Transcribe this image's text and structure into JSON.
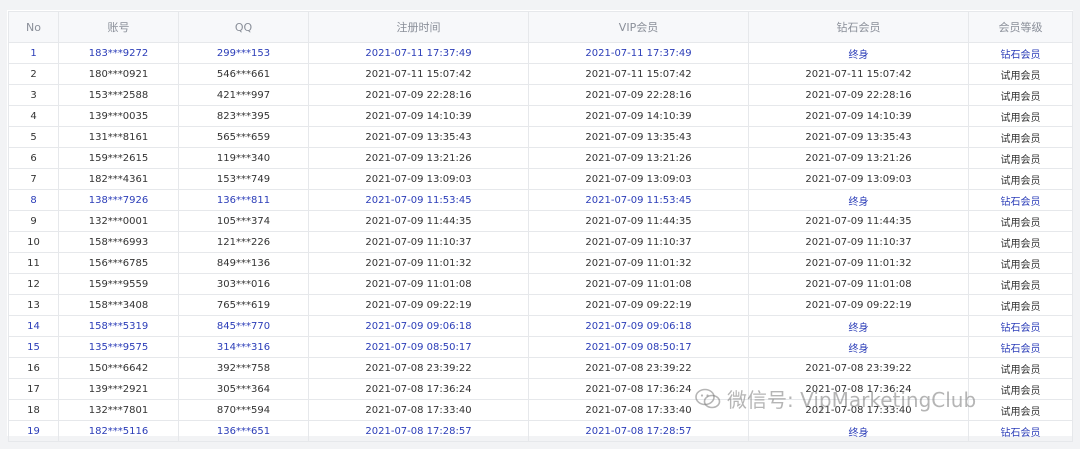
{
  "table": {
    "columns": [
      "No",
      "账号",
      "QQ",
      "注册时间",
      "VIP会员",
      "钻石会员",
      "会员等级"
    ],
    "rows": [
      {
        "no": "1",
        "account": "183***9272",
        "qq": "299***153",
        "registered": "2021-07-11 17:37:49",
        "vip": "2021-07-11 17:37:49",
        "diamond": "终身",
        "level": "钻石会员"
      },
      {
        "no": "2",
        "account": "180***0921",
        "qq": "546***661",
        "registered": "2021-07-11 15:07:42",
        "vip": "2021-07-11 15:07:42",
        "diamond": "2021-07-11 15:07:42",
        "level": "试用会员"
      },
      {
        "no": "3",
        "account": "153***2588",
        "qq": "421***997",
        "registered": "2021-07-09 22:28:16",
        "vip": "2021-07-09 22:28:16",
        "diamond": "2021-07-09 22:28:16",
        "level": "试用会员"
      },
      {
        "no": "4",
        "account": "139***0035",
        "qq": "823***395",
        "registered": "2021-07-09 14:10:39",
        "vip": "2021-07-09 14:10:39",
        "diamond": "2021-07-09 14:10:39",
        "level": "试用会员"
      },
      {
        "no": "5",
        "account": "131***8161",
        "qq": "565***659",
        "registered": "2021-07-09 13:35:43",
        "vip": "2021-07-09 13:35:43",
        "diamond": "2021-07-09 13:35:43",
        "level": "试用会员"
      },
      {
        "no": "6",
        "account": "159***2615",
        "qq": "119***340",
        "registered": "2021-07-09 13:21:26",
        "vip": "2021-07-09 13:21:26",
        "diamond": "2021-07-09 13:21:26",
        "level": "试用会员"
      },
      {
        "no": "7",
        "account": "182***4361",
        "qq": "153***749",
        "registered": "2021-07-09 13:09:03",
        "vip": "2021-07-09 13:09:03",
        "diamond": "2021-07-09 13:09:03",
        "level": "试用会员"
      },
      {
        "no": "8",
        "account": "138***7926",
        "qq": "136***811",
        "registered": "2021-07-09 11:53:45",
        "vip": "2021-07-09 11:53:45",
        "diamond": "终身",
        "level": "钻石会员"
      },
      {
        "no": "9",
        "account": "132***0001",
        "qq": "105***374",
        "registered": "2021-07-09 11:44:35",
        "vip": "2021-07-09 11:44:35",
        "diamond": "2021-07-09 11:44:35",
        "level": "试用会员"
      },
      {
        "no": "10",
        "account": "158***6993",
        "qq": "121***226",
        "registered": "2021-07-09 11:10:37",
        "vip": "2021-07-09 11:10:37",
        "diamond": "2021-07-09 11:10:37",
        "level": "试用会员"
      },
      {
        "no": "11",
        "account": "156***6785",
        "qq": "849***136",
        "registered": "2021-07-09 11:01:32",
        "vip": "2021-07-09 11:01:32",
        "diamond": "2021-07-09 11:01:32",
        "level": "试用会员"
      },
      {
        "no": "12",
        "account": "159***9559",
        "qq": "303***016",
        "registered": "2021-07-09 11:01:08",
        "vip": "2021-07-09 11:01:08",
        "diamond": "2021-07-09 11:01:08",
        "level": "试用会员"
      },
      {
        "no": "13",
        "account": "158***3408",
        "qq": "765***619",
        "registered": "2021-07-09 09:22:19",
        "vip": "2021-07-09 09:22:19",
        "diamond": "2021-07-09 09:22:19",
        "level": "试用会员"
      },
      {
        "no": "14",
        "account": "158***5319",
        "qq": "845***770",
        "registered": "2021-07-09 09:06:18",
        "vip": "2021-07-09 09:06:18",
        "diamond": "终身",
        "level": "钻石会员"
      },
      {
        "no": "15",
        "account": "135***9575",
        "qq": "314***316",
        "registered": "2021-07-09 08:50:17",
        "vip": "2021-07-09 08:50:17",
        "diamond": "终身",
        "level": "钻石会员"
      },
      {
        "no": "16",
        "account": "150***6642",
        "qq": "392***758",
        "registered": "2021-07-08 23:39:22",
        "vip": "2021-07-08 23:39:22",
        "diamond": "2021-07-08 23:39:22",
        "level": "试用会员"
      },
      {
        "no": "17",
        "account": "139***2921",
        "qq": "305***364",
        "registered": "2021-07-08 17:36:24",
        "vip": "2021-07-08 17:36:24",
        "diamond": "2021-07-08 17:36:24",
        "level": "试用会员"
      },
      {
        "no": "18",
        "account": "132***7801",
        "qq": "870***594",
        "registered": "2021-07-08 17:33:40",
        "vip": "2021-07-08 17:33:40",
        "diamond": "2021-07-08 17:33:40",
        "level": "试用会员"
      },
      {
        "no": "19",
        "account": "182***5116",
        "qq": "136***651",
        "registered": "2021-07-08 17:28:57",
        "vip": "2021-07-08 17:28:57",
        "diamond": "终身",
        "level": "钻石会员"
      }
    ]
  },
  "watermark": {
    "text": "微信号: VipMarketingClub",
    "icon": "wechat-icon"
  },
  "colors": {
    "diamond_row_text": "#2b3db8",
    "normal_row_text": "#333333",
    "header_text": "#8a8f99"
  }
}
